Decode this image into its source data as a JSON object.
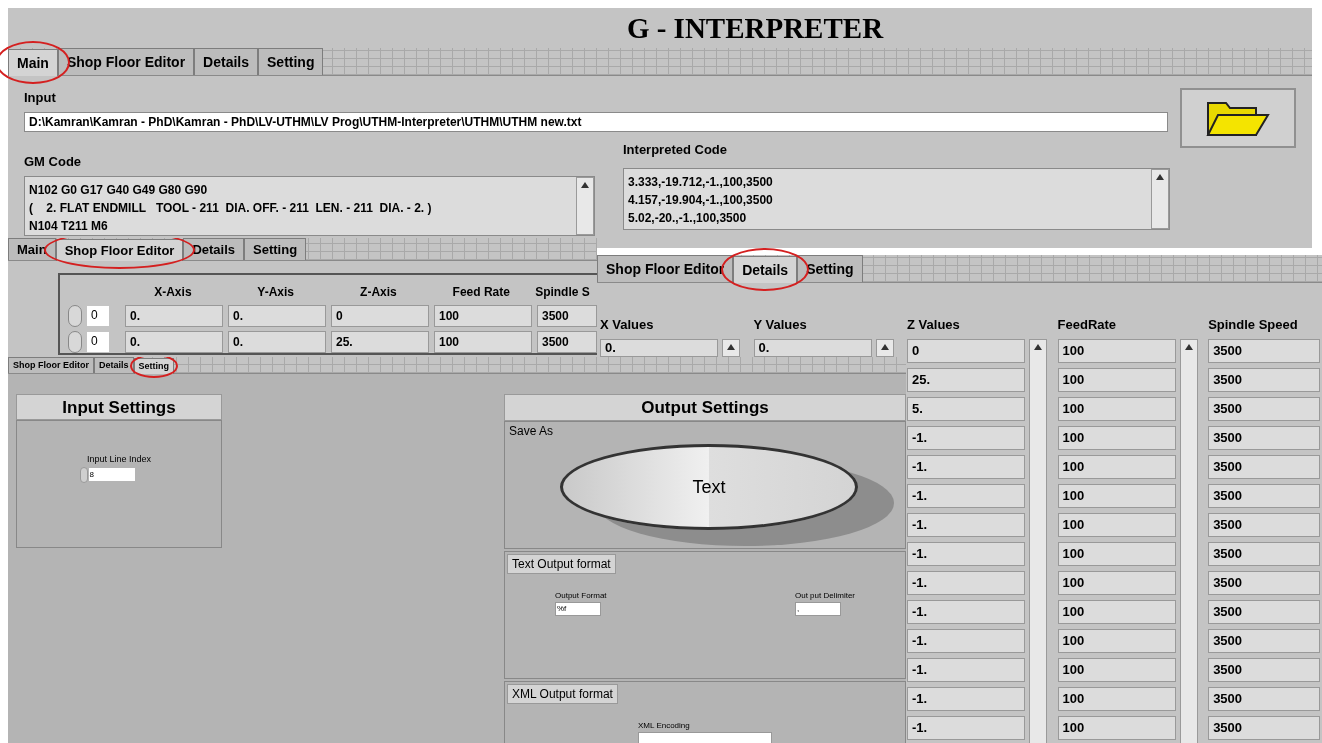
{
  "main_panel": {
    "title": "G - INTERPRETER",
    "tabs": [
      {
        "label": "Main",
        "selected": true
      },
      {
        "label": "Shop Floor Editor",
        "selected": false
      },
      {
        "label": "Details",
        "selected": false
      },
      {
        "label": "Setting",
        "selected": false
      }
    ],
    "input": {
      "label": "Input",
      "value": "D:\\Kamran\\Kamran - PhD\\Kamran - PhD\\LV-UTHM\\LV Prog\\UTHM-Interpreter\\UTHM\\UTHM new.txt"
    },
    "gm_code": {
      "label": "GM Code",
      "lines": [
        "N102 G0 G17 G40 G49 G80 G90",
        "(    2. FLAT ENDMILL   TOOL - 211  DIA. OFF. - 211  LEN. - 211  DIA. - 2. )",
        "N104 T211 M6"
      ]
    },
    "interpreted_code": {
      "label": "Interpreted Code",
      "lines": [
        "3.333,-19.712,-1.,100,3500",
        "4.157,-19.904,-1.,100,3500",
        "5.02,-20.,-1.,100,3500"
      ]
    }
  },
  "shop_floor_panel": {
    "tabs": [
      {
        "label": "Main",
        "selected": false
      },
      {
        "label": "Shop Floor Editor",
        "selected": true
      },
      {
        "label": "Details",
        "selected": false
      },
      {
        "label": "Setting",
        "selected": false
      }
    ],
    "columns": [
      "X-Axis",
      "Y-Axis",
      "Z-Axis",
      "Feed Rate",
      "Spindle S"
    ],
    "rows": [
      {
        "index": "0",
        "cells": [
          "0.",
          "0.",
          "0",
          "100",
          "3500"
        ]
      },
      {
        "index": "0",
        "cells": [
          "0.",
          "0.",
          "25.",
          "100",
          "3500"
        ]
      }
    ]
  },
  "details_panel": {
    "tabs": [
      {
        "label": "Shop Floor Editor",
        "selected": false
      },
      {
        "label": "Details",
        "selected": true
      },
      {
        "label": "Setting",
        "selected": false
      }
    ],
    "columns": [
      {
        "header": "X Values",
        "values": [
          "0."
        ]
      },
      {
        "header": "Y Values",
        "values": [
          "0."
        ]
      },
      {
        "header": "Z Values",
        "values": [
          "0",
          "25.",
          "5.",
          "-1.",
          "-1.",
          "-1.",
          "-1.",
          "-1.",
          "-1.",
          "-1.",
          "-1.",
          "-1.",
          "-1.",
          "-1."
        ]
      },
      {
        "header": "FeedRate",
        "values": [
          "100",
          "100",
          "100",
          "100",
          "100",
          "100",
          "100",
          "100",
          "100",
          "100",
          "100",
          "100",
          "100",
          "100"
        ]
      },
      {
        "header": "Spindle Speed",
        "values": [
          "3500",
          "3500",
          "3500",
          "3500",
          "3500",
          "3500",
          "3500",
          "3500",
          "3500",
          "3500",
          "3500",
          "3500",
          "3500",
          "3500"
        ]
      }
    ]
  },
  "setting_panel": {
    "tabs": [
      {
        "label": "Shop Floor Editor",
        "selected": false
      },
      {
        "label": "Details",
        "selected": false
      },
      {
        "label": "Setting",
        "selected": true
      }
    ],
    "input_settings": {
      "title": "Input Settings",
      "field_label": "Input Line Index",
      "value": "8"
    },
    "output_settings": {
      "title": "Output Settings",
      "save_as_label": "Save As",
      "save_as_button": "Text",
      "text_output": {
        "title": "Text Output format",
        "fields": [
          {
            "label": "Output Format",
            "value": "%f"
          },
          {
            "label": "Out put Delimiter",
            "value": ","
          }
        ]
      },
      "xml_output": {
        "title": "XML Output format",
        "fields": [
          {
            "label": "XML Encoding"
          }
        ]
      }
    }
  }
}
